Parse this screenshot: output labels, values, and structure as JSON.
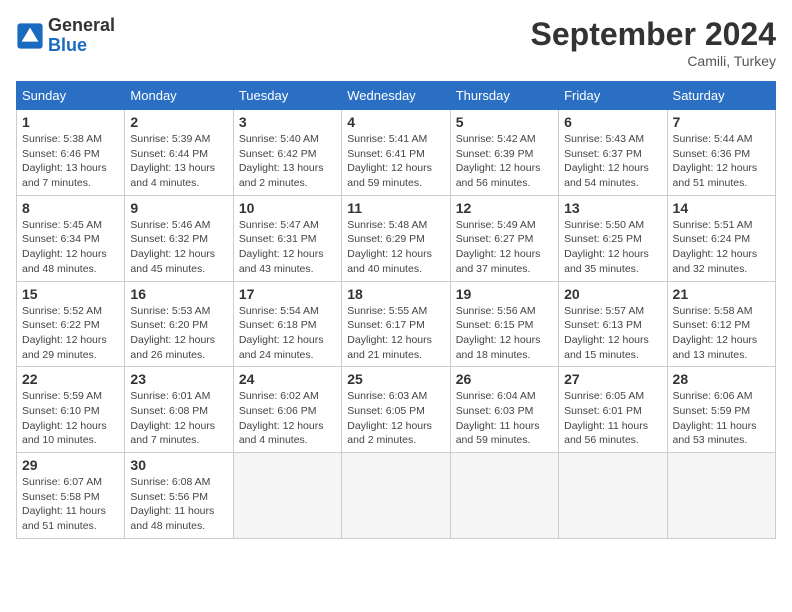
{
  "header": {
    "logo_line1": "General",
    "logo_line2": "Blue",
    "month": "September 2024",
    "location": "Camili, Turkey"
  },
  "days_of_week": [
    "Sunday",
    "Monday",
    "Tuesday",
    "Wednesday",
    "Thursday",
    "Friday",
    "Saturday"
  ],
  "weeks": [
    [
      {
        "day": "1",
        "info": "Sunrise: 5:38 AM\nSunset: 6:46 PM\nDaylight: 13 hours\nand 7 minutes."
      },
      {
        "day": "2",
        "info": "Sunrise: 5:39 AM\nSunset: 6:44 PM\nDaylight: 13 hours\nand 4 minutes."
      },
      {
        "day": "3",
        "info": "Sunrise: 5:40 AM\nSunset: 6:42 PM\nDaylight: 13 hours\nand 2 minutes."
      },
      {
        "day": "4",
        "info": "Sunrise: 5:41 AM\nSunset: 6:41 PM\nDaylight: 12 hours\nand 59 minutes."
      },
      {
        "day": "5",
        "info": "Sunrise: 5:42 AM\nSunset: 6:39 PM\nDaylight: 12 hours\nand 56 minutes."
      },
      {
        "day": "6",
        "info": "Sunrise: 5:43 AM\nSunset: 6:37 PM\nDaylight: 12 hours\nand 54 minutes."
      },
      {
        "day": "7",
        "info": "Sunrise: 5:44 AM\nSunset: 6:36 PM\nDaylight: 12 hours\nand 51 minutes."
      }
    ],
    [
      {
        "day": "8",
        "info": "Sunrise: 5:45 AM\nSunset: 6:34 PM\nDaylight: 12 hours\nand 48 minutes."
      },
      {
        "day": "9",
        "info": "Sunrise: 5:46 AM\nSunset: 6:32 PM\nDaylight: 12 hours\nand 45 minutes."
      },
      {
        "day": "10",
        "info": "Sunrise: 5:47 AM\nSunset: 6:31 PM\nDaylight: 12 hours\nand 43 minutes."
      },
      {
        "day": "11",
        "info": "Sunrise: 5:48 AM\nSunset: 6:29 PM\nDaylight: 12 hours\nand 40 minutes."
      },
      {
        "day": "12",
        "info": "Sunrise: 5:49 AM\nSunset: 6:27 PM\nDaylight: 12 hours\nand 37 minutes."
      },
      {
        "day": "13",
        "info": "Sunrise: 5:50 AM\nSunset: 6:25 PM\nDaylight: 12 hours\nand 35 minutes."
      },
      {
        "day": "14",
        "info": "Sunrise: 5:51 AM\nSunset: 6:24 PM\nDaylight: 12 hours\nand 32 minutes."
      }
    ],
    [
      {
        "day": "15",
        "info": "Sunrise: 5:52 AM\nSunset: 6:22 PM\nDaylight: 12 hours\nand 29 minutes."
      },
      {
        "day": "16",
        "info": "Sunrise: 5:53 AM\nSunset: 6:20 PM\nDaylight: 12 hours\nand 26 minutes."
      },
      {
        "day": "17",
        "info": "Sunrise: 5:54 AM\nSunset: 6:18 PM\nDaylight: 12 hours\nand 24 minutes."
      },
      {
        "day": "18",
        "info": "Sunrise: 5:55 AM\nSunset: 6:17 PM\nDaylight: 12 hours\nand 21 minutes."
      },
      {
        "day": "19",
        "info": "Sunrise: 5:56 AM\nSunset: 6:15 PM\nDaylight: 12 hours\nand 18 minutes."
      },
      {
        "day": "20",
        "info": "Sunrise: 5:57 AM\nSunset: 6:13 PM\nDaylight: 12 hours\nand 15 minutes."
      },
      {
        "day": "21",
        "info": "Sunrise: 5:58 AM\nSunset: 6:12 PM\nDaylight: 12 hours\nand 13 minutes."
      }
    ],
    [
      {
        "day": "22",
        "info": "Sunrise: 5:59 AM\nSunset: 6:10 PM\nDaylight: 12 hours\nand 10 minutes."
      },
      {
        "day": "23",
        "info": "Sunrise: 6:01 AM\nSunset: 6:08 PM\nDaylight: 12 hours\nand 7 minutes."
      },
      {
        "day": "24",
        "info": "Sunrise: 6:02 AM\nSunset: 6:06 PM\nDaylight: 12 hours\nand 4 minutes."
      },
      {
        "day": "25",
        "info": "Sunrise: 6:03 AM\nSunset: 6:05 PM\nDaylight: 12 hours\nand 2 minutes."
      },
      {
        "day": "26",
        "info": "Sunrise: 6:04 AM\nSunset: 6:03 PM\nDaylight: 11 hours\nand 59 minutes."
      },
      {
        "day": "27",
        "info": "Sunrise: 6:05 AM\nSunset: 6:01 PM\nDaylight: 11 hours\nand 56 minutes."
      },
      {
        "day": "28",
        "info": "Sunrise: 6:06 AM\nSunset: 5:59 PM\nDaylight: 11 hours\nand 53 minutes."
      }
    ],
    [
      {
        "day": "29",
        "info": "Sunrise: 6:07 AM\nSunset: 5:58 PM\nDaylight: 11 hours\nand 51 minutes."
      },
      {
        "day": "30",
        "info": "Sunrise: 6:08 AM\nSunset: 5:56 PM\nDaylight: 11 hours\nand 48 minutes."
      },
      {
        "day": "",
        "info": ""
      },
      {
        "day": "",
        "info": ""
      },
      {
        "day": "",
        "info": ""
      },
      {
        "day": "",
        "info": ""
      },
      {
        "day": "",
        "info": ""
      }
    ]
  ]
}
